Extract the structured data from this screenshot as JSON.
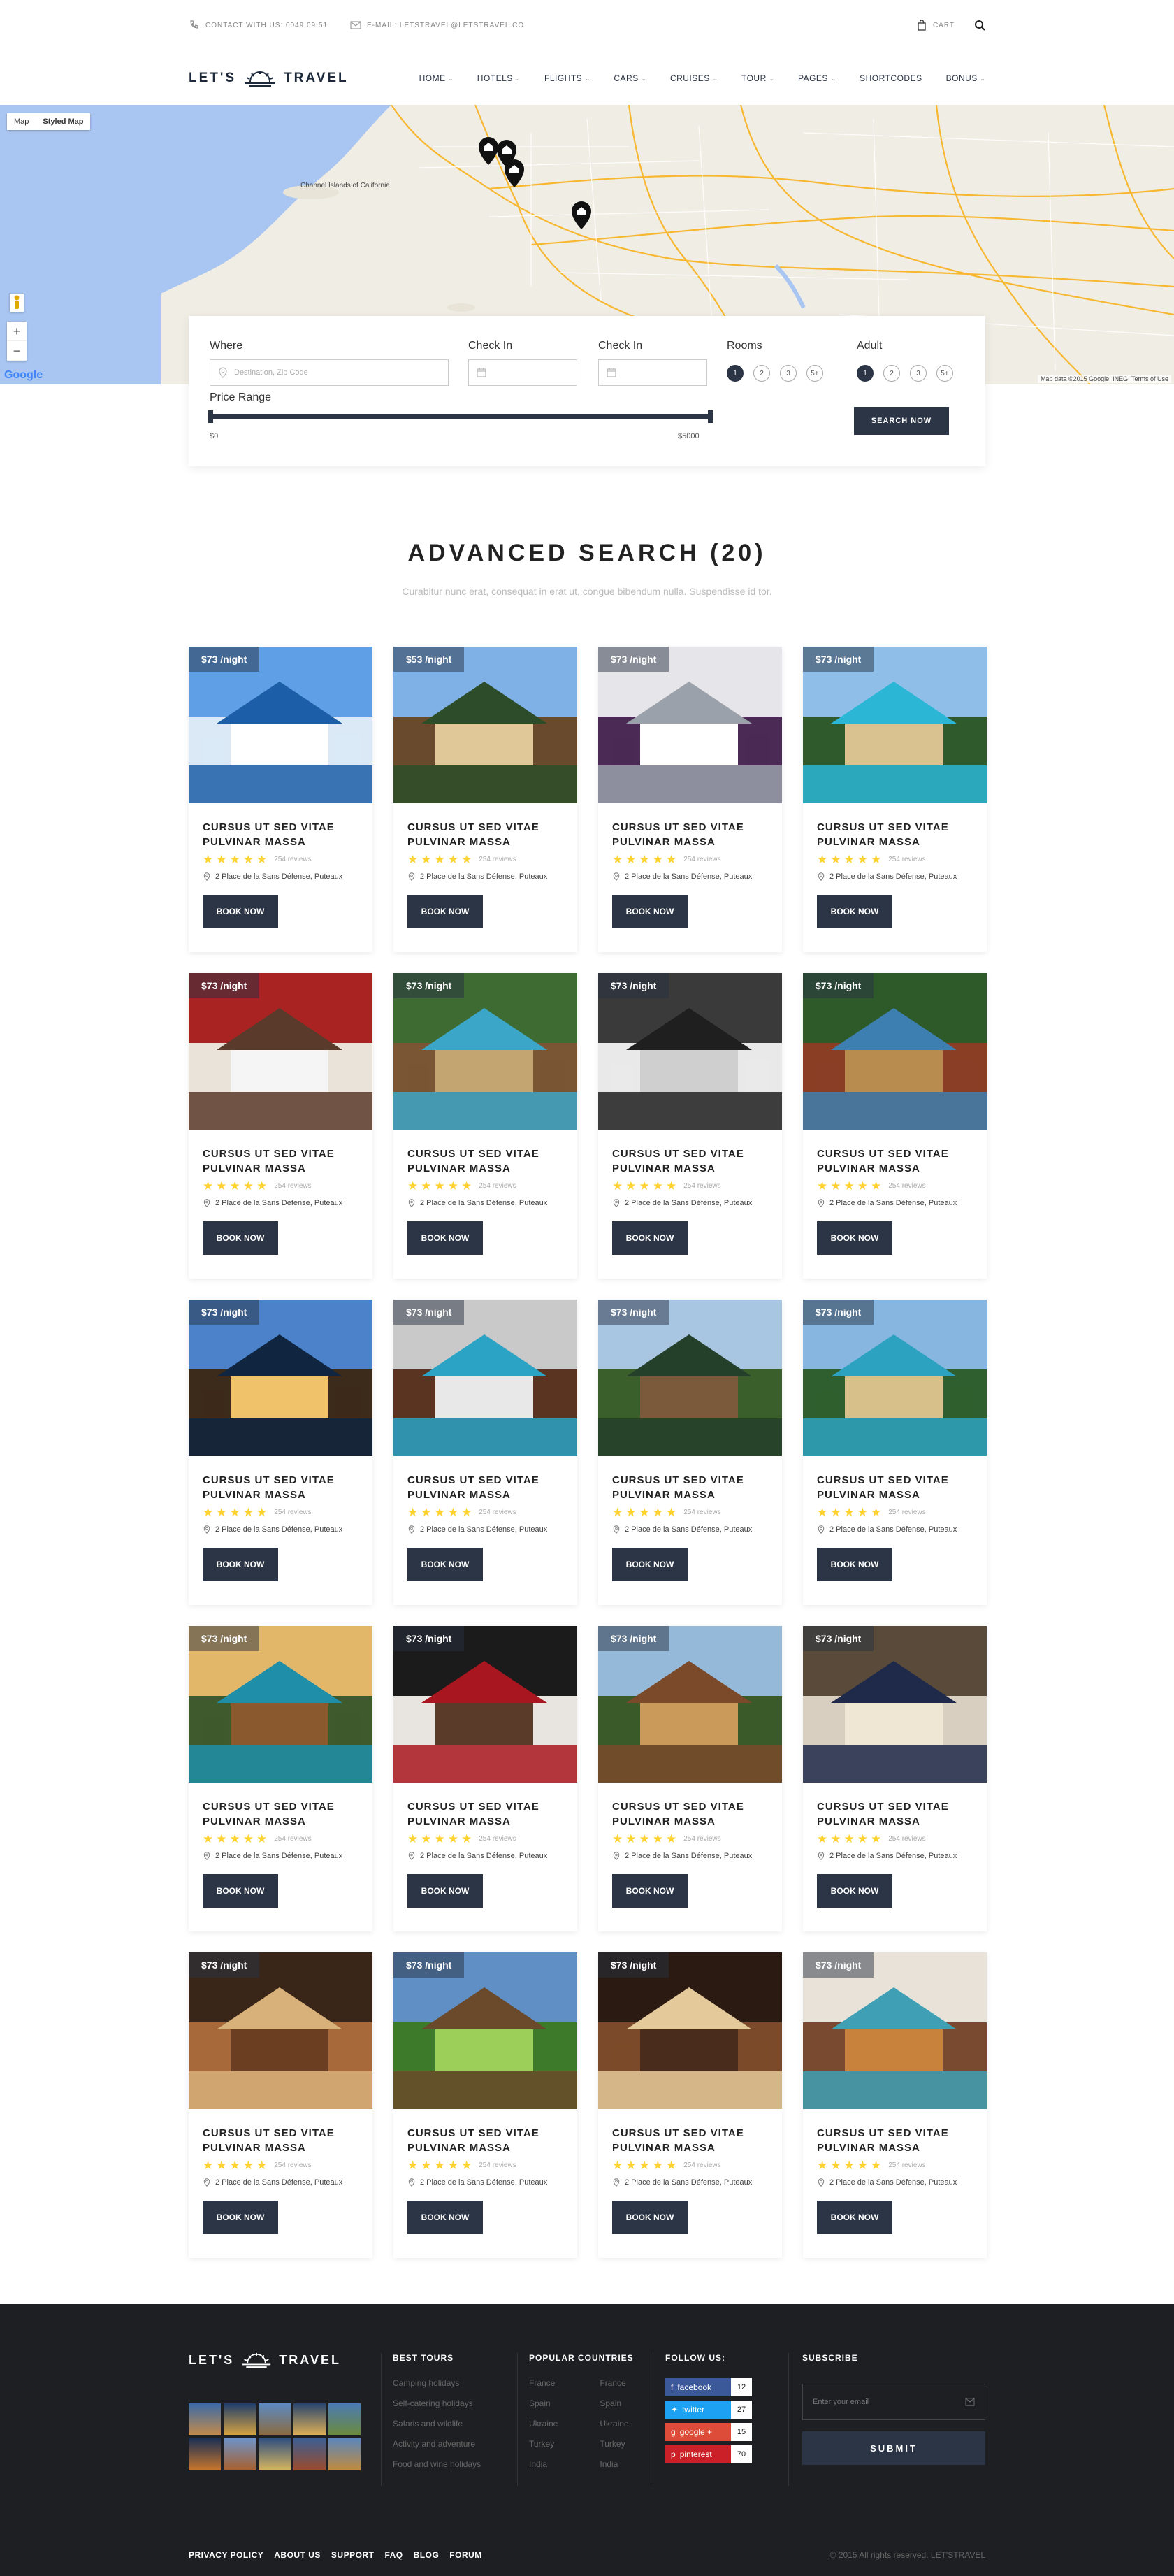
{
  "topbar": {
    "contact": "CONTACT WITH US: 0049 09 51",
    "email": "E-MAIL: LETSTRAVEL@LETSTRAVEL.CO",
    "cart": "CART"
  },
  "logo": {
    "left": "LET'S",
    "right": "TRAVEL"
  },
  "nav": [
    "HOME",
    "HOTELS",
    "FLIGHTS",
    "CARS",
    "CRUISES",
    "TOUR",
    "PAGES",
    "SHORTCODES",
    "BONUS"
  ],
  "map": {
    "tab_map": "Map",
    "tab_styled": "Styled Map",
    "label_island": "Channel Islands of California",
    "attribution": "Map data ©2015 Google, INEGI    Terms of Use",
    "google": "Google"
  },
  "search": {
    "where_label": "Where",
    "where_placeholder": "Destination, Zip Code",
    "checkin_label": "Check In",
    "checkout_label": "Check In",
    "rooms_label": "Rooms",
    "adult_label": "Adult",
    "options": [
      "1",
      "2",
      "3",
      "5+"
    ],
    "price_label": "Price Range",
    "price_min": "$0",
    "price_max": "$5000",
    "button": "SEARCH NOW"
  },
  "section": {
    "title": "ADVANCED SEARCH (20)",
    "subtitle": "Curabitur nunc erat, consequat in erat ut, congue bibendum nulla. Suspendisse id tor."
  },
  "card_common": {
    "title": "CURSUS UT SED VITAE PULVINAR MASSA",
    "reviews": "254 reviews",
    "address": "2 Place de la Sans Défense, Puteaux",
    "button": "BOOK NOW",
    "stars": 5
  },
  "cards": [
    {
      "price": "$73 /night",
      "scene": "santorini"
    },
    {
      "price": "$53 /night",
      "scene": "villa"
    },
    {
      "price": "$73 /night",
      "scene": "kitchen"
    },
    {
      "price": "$73 /night",
      "scene": "pool"
    },
    {
      "price": "$73 /night",
      "scene": "bedroom-red"
    },
    {
      "price": "$73 /night",
      "scene": "tropic-pool"
    },
    {
      "price": "$73 /night",
      "scene": "interior"
    },
    {
      "price": "$73 /night",
      "scene": "resort"
    },
    {
      "price": "$73 /night",
      "scene": "villa-night"
    },
    {
      "price": "$73 /night",
      "scene": "kitchen-wood"
    },
    {
      "price": "$73 /night",
      "scene": "jungle"
    },
    {
      "price": "$73 /night",
      "scene": "palms-pool"
    },
    {
      "price": "$73 /night",
      "scene": "infinity"
    },
    {
      "price": "$73 /night",
      "scene": "bedroom-dark"
    },
    {
      "price": "$73 /night",
      "scene": "bali"
    },
    {
      "price": "$73 /night",
      "scene": "bedroom-blue"
    },
    {
      "price": "$73 /night",
      "scene": "lobby"
    },
    {
      "price": "$73 /night",
      "scene": "garden"
    },
    {
      "price": "$73 /night",
      "scene": "suite"
    },
    {
      "price": "$73 /night",
      "scene": "spa"
    }
  ],
  "footer": {
    "best_tours_title": "BEST TOURS",
    "best_tours": [
      "Camping holidays",
      "Self-catering holidays",
      "Safaris and wildlife",
      "Activity and adventure",
      "Food and wine holidays"
    ],
    "countries_title": "POPULAR COUNTRIES",
    "countries_a": [
      "France",
      "Spain",
      "Ukraine",
      "Turkey",
      "India"
    ],
    "countries_b": [
      "France",
      "Spain",
      "Ukraine",
      "Turkey",
      "India"
    ],
    "follow_title": "FOLLOW US:",
    "social": [
      {
        "name": "facebook",
        "count": "12",
        "color": "#3b5998"
      },
      {
        "name": "twitter",
        "count": "27",
        "color": "#1da1f2"
      },
      {
        "name": "google +",
        "count": "15",
        "color": "#dd4b39"
      },
      {
        "name": "pinterest",
        "count": "70",
        "color": "#cb2027"
      }
    ],
    "subscribe_title": "SUBSCRIBE",
    "email_placeholder": "Enter your email",
    "submit": "SUBMIT",
    "links": [
      "PRIVACY POLICY",
      "ABOUT US",
      "SUPPORT",
      "FAQ",
      "BLOG",
      "FORUM"
    ],
    "copyright": "© 2015 All rights reserved. LET'STRAVEL"
  }
}
